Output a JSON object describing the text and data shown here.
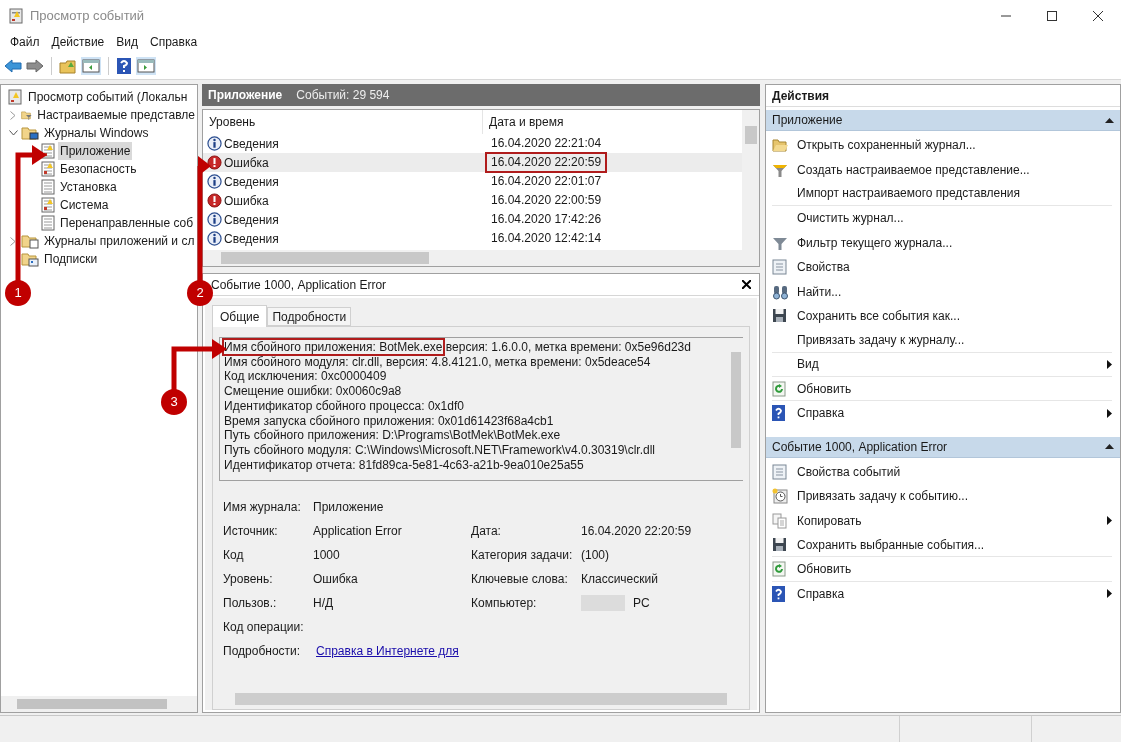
{
  "window": {
    "title": "Просмотр событий"
  },
  "menu": [
    "Файл",
    "Действие",
    "Вид",
    "Справка"
  ],
  "tree": [
    {
      "label": "Просмотр событий (Локальн",
      "kind": "viewer",
      "selected": false,
      "children": [
        {
          "label": "Настраиваемые представле",
          "kind": "folder_filter",
          "expanded": false,
          "selected": false
        },
        {
          "label": "Журналы Windows",
          "kind": "folder_pc",
          "expanded": true,
          "selected": false,
          "children": [
            {
              "label": "Приложение",
              "kind": "log_alert",
              "selected": true
            },
            {
              "label": "Безопасность",
              "kind": "log_alert",
              "selected": false
            },
            {
              "label": "Установка",
              "kind": "log_plain",
              "selected": false
            },
            {
              "label": "Система",
              "kind": "log_alert",
              "selected": false
            },
            {
              "label": "Перенаправленные соб",
              "kind": "log_plain",
              "selected": false
            }
          ]
        },
        {
          "label": "Журналы приложений и сл",
          "kind": "folder_doc",
          "expanded": false,
          "selected": false
        },
        {
          "label": "Подписки",
          "kind": "folder_sub",
          "selected": false
        }
      ]
    }
  ],
  "log_header": {
    "title": "Приложение",
    "count": "Событий: 29 594"
  },
  "events": {
    "columns": [
      "Уровень",
      "Дата и время"
    ],
    "rows": [
      {
        "kind": "info",
        "level": "Сведения",
        "datetime": "16.04.2020 22:21:04",
        "selected": false,
        "framed": false
      },
      {
        "kind": "error",
        "level": "Ошибка",
        "datetime": "16.04.2020 22:20:59",
        "selected": true,
        "framed": true
      },
      {
        "kind": "info",
        "level": "Сведения",
        "datetime": "16.04.2020 22:01:07",
        "selected": false,
        "framed": false
      },
      {
        "kind": "error",
        "level": "Ошибка",
        "datetime": "16.04.2020 22:00:59",
        "selected": false,
        "framed": false
      },
      {
        "kind": "info",
        "level": "Сведения",
        "datetime": "16.04.2020 17:42:26",
        "selected": false,
        "framed": false
      },
      {
        "kind": "info",
        "level": "Сведения",
        "datetime": "16.04.2020 12:42:14",
        "selected": false,
        "framed": false
      }
    ]
  },
  "detail": {
    "title": "Событие 1000, Application Error",
    "tabs": [
      {
        "label": "Общие",
        "selected": true
      },
      {
        "label": "Подробности",
        "selected": false
      }
    ],
    "description": [
      [
        {
          "text": "Имя сбойного приложения: BotMek.exe",
          "framed": true
        },
        {
          "text": " версия: 1.6.0.0, метка времени: 0x5e96d23d",
          "framed": false
        }
      ],
      [
        {
          "text": "Имя сбойного модуля: clr.dll, версия: 4.8.4121.0, метка времени: 0x5deace54",
          "framed": false
        }
      ],
      [
        {
          "text": "Код исключения: 0xc0000409",
          "framed": false
        }
      ],
      [
        {
          "text": "Смещение ошибки: 0x0060c9a8",
          "framed": false
        }
      ],
      [
        {
          "text": "Идентификатор сбойного процесса: 0x1df0",
          "framed": false
        }
      ],
      [
        {
          "text": "Время запуска сбойного приложения: 0x01d61423f68a4cb1",
          "framed": false
        }
      ],
      [
        {
          "text": "Путь сбойного приложения: D:\\Programs\\BotMek\\BotMek.exe",
          "framed": false
        }
      ],
      [
        {
          "text": "Путь сбойного модуля: C:\\Windows\\Microsoft.NET\\Framework\\v4.0.30319\\clr.dll",
          "framed": false
        }
      ],
      [
        {
          "text": "Идентификатор отчета: 81fd89ca-5e81-4c63-a21b-9ea010e25a55",
          "framed": false
        }
      ]
    ],
    "fields": [
      {
        "left": {
          "label": "Имя журнала:",
          "value": "Приложение"
        }
      },
      {
        "left": {
          "label": "Источник:",
          "value": "Application Error"
        },
        "right": {
          "label": "Дата:",
          "value": "16.04.2020 22:20:59"
        }
      },
      {
        "left": {
          "label": "Код",
          "value": "1000"
        },
        "right": {
          "label": "Категория задачи:",
          "value": "(100)"
        }
      },
      {
        "left": {
          "label": "Уровень:",
          "value": "Ошибка"
        },
        "right": {
          "label": "Ключевые слова:",
          "value": "Классический"
        }
      },
      {
        "left": {
          "label": "Пользов.:",
          "value": "Н/Д"
        },
        "right": {
          "label": "Компьютер:",
          "value": "PC",
          "redacted": true
        }
      },
      {
        "left": {
          "label": "Код операции:"
        }
      },
      {
        "left": {
          "label": "Подробности:",
          "link": "Справка в Интернете для"
        }
      }
    ]
  },
  "actions": {
    "title": "Действия",
    "sections": [
      {
        "title": "Приложение",
        "expanded": true,
        "items": [
          {
            "label": "Открыть сохраненный журнал...",
            "kind": "folder",
            "submenu": false,
            "separator": false
          },
          {
            "label": "Создать настраиваемое представление...",
            "kind": "filter_new",
            "submenu": false,
            "separator": false
          },
          {
            "label": "Импорт настраиваемого представления",
            "kind": "plain",
            "submenu": false,
            "separator": true
          },
          {
            "label": "Очистить журнал...",
            "kind": "plain",
            "submenu": false,
            "separator": false
          },
          {
            "label": "Фильтр текущего журнала...",
            "kind": "filter",
            "submenu": false,
            "separator": false
          },
          {
            "label": "Свойства",
            "kind": "properties",
            "submenu": false,
            "separator": false
          },
          {
            "label": "Найти...",
            "kind": "find",
            "submenu": false,
            "separator": false
          },
          {
            "label": "Сохранить все события как...",
            "kind": "save",
            "submenu": false,
            "separator": false
          },
          {
            "label": "Привязать задачу к журналу...",
            "kind": "plain",
            "submenu": false,
            "separator": true
          },
          {
            "label": "Вид",
            "kind": "plain",
            "submenu": true,
            "separator": true
          },
          {
            "label": "Обновить",
            "kind": "refresh",
            "submenu": false,
            "separator": true
          },
          {
            "label": "Справка",
            "kind": "help",
            "submenu": true,
            "separator": false
          }
        ]
      },
      {
        "title": "Событие 1000, Application Error",
        "expanded": true,
        "items": [
          {
            "label": "Свойства событий",
            "kind": "properties",
            "submenu": false,
            "separator": false
          },
          {
            "label": "Привязать задачу к событию...",
            "kind": "task",
            "submenu": false,
            "separator": false
          },
          {
            "label": "Копировать",
            "kind": "copy",
            "submenu": true,
            "separator": false
          },
          {
            "label": "Сохранить выбранные события...",
            "kind": "save",
            "submenu": false,
            "separator": true
          },
          {
            "label": "Обновить",
            "kind": "refresh",
            "submenu": false,
            "separator": true
          },
          {
            "label": "Справка",
            "kind": "help",
            "submenu": true,
            "separator": false
          }
        ]
      }
    ]
  },
  "annotations": [
    {
      "label": "1"
    },
    {
      "label": "2"
    },
    {
      "label": "3"
    }
  ]
}
